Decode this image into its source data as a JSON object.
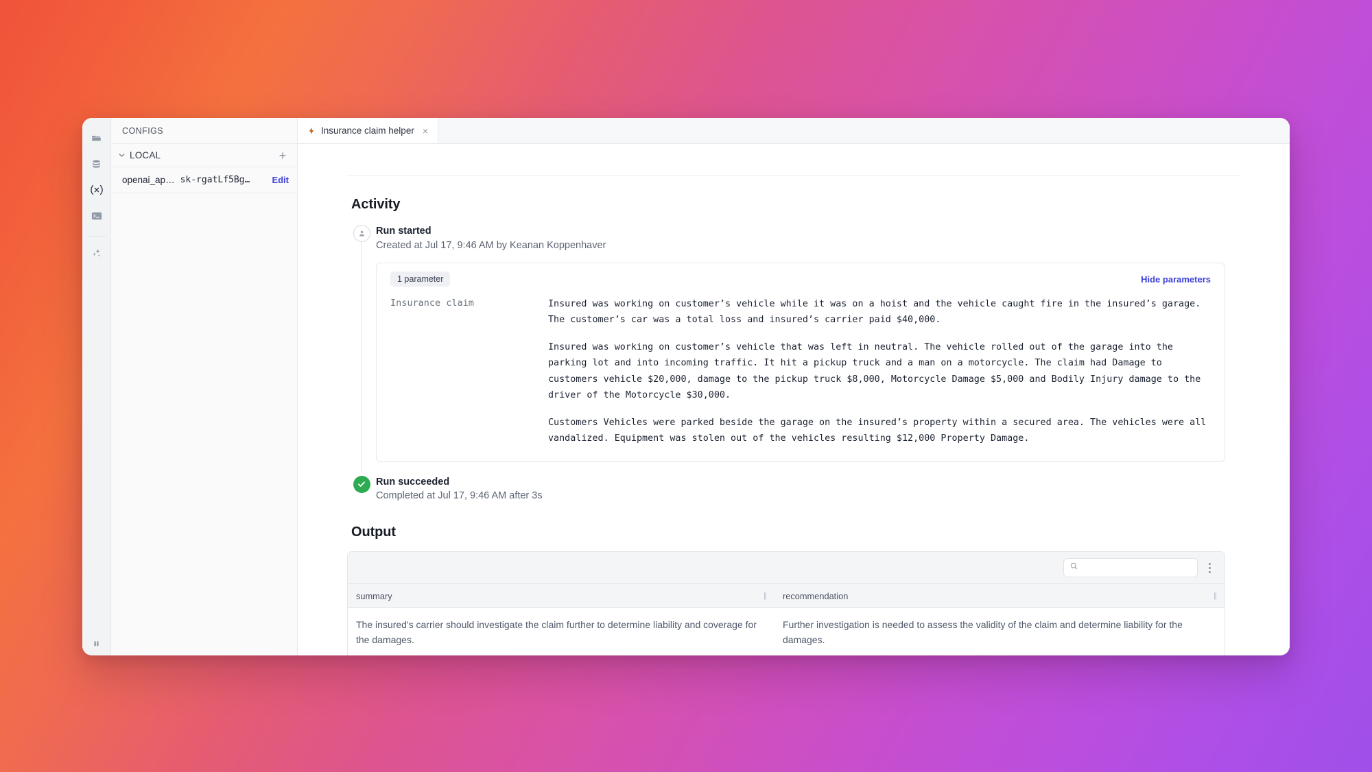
{
  "window": {
    "title": "Insurance claim helper"
  },
  "rail": {
    "icons": [
      {
        "name": "folder-icon",
        "label": "Files"
      },
      {
        "name": "database-icon",
        "label": "Databases"
      },
      {
        "name": "variables-icon",
        "label": "(x)"
      },
      {
        "name": "terminal-icon",
        "label": "Terminal"
      },
      {
        "name": "sparkles-icon",
        "label": "AI"
      }
    ],
    "bottom_icon": "panel-toggle-icon"
  },
  "configs": {
    "title": "CONFIGS",
    "group_label": "LOCAL",
    "add_label": "+",
    "items": [
      {
        "key": "openai_ap…",
        "value": "sk-rgatLf5Bg…",
        "action_label": "Edit"
      }
    ]
  },
  "tabs": [
    {
      "label": "Insurance claim helper",
      "icon": "lightning-bolt-icon",
      "close_label": "×",
      "active": true
    }
  ],
  "activity": {
    "heading": "Activity",
    "events": [
      {
        "title": "Run started",
        "subtitle": "Created at Jul 17, 9:46 AM by Keanan Koppenhaver",
        "icon": "user-avatar-icon"
      },
      {
        "title": "Run succeeded",
        "subtitle": "Completed at Jul 17, 9:46 AM after 3s",
        "icon": "check-circle-icon",
        "status_color": "#2eab52"
      }
    ],
    "parameters": {
      "badge": "1 parameter",
      "toggle_label": "Hide parameters",
      "toggle_color": "#3d42d8",
      "name": "Insurance claim",
      "paragraphs": [
        "Insured was working on customer’s vehicle while it was on a hoist and the vehicle caught fire in the insured’s garage. The customer’s car was a total loss and insured’s carrier paid $40,000.",
        "Insured was working on customer’s vehicle that was left in neutral. The vehicle rolled out of the garage into the parking lot and into incoming traffic. It hit a pickup truck and a man on a motorcycle. The claim had Damage to customers vehicle $20,000, damage to the pickup truck $8,000, Motorcycle Damage $5,000 and Bodily Injury damage to the driver of the Motorcycle $30,000.",
        "Customers Vehicles were parked beside the garage on the insured’s property within a secured area. The vehicles were all vandalized. Equipment was stolen out of the vehicles resulting $12,000 Property Damage."
      ]
    }
  },
  "output": {
    "heading": "Output",
    "search": {
      "value": "",
      "placeholder": "",
      "icon": "search-icon"
    },
    "menu_icon": "kebab-menu-icon",
    "columns": [
      {
        "key": "summary",
        "label": "summary"
      },
      {
        "key": "recommendation",
        "label": "recommendation"
      }
    ],
    "rows": [
      {
        "summary": "The insured's carrier should investigate the claim further to determine liability and coverage for the damages.",
        "recommendation": "Further investigation is needed to assess the validity of the claim and determine liability for the damages."
      }
    ]
  }
}
